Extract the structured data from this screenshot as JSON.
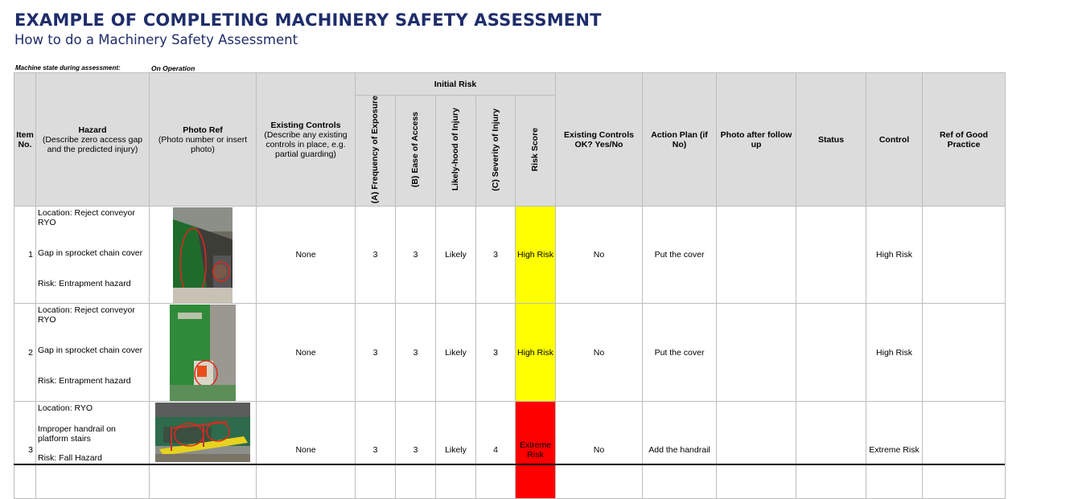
{
  "header": {
    "title": "EXAMPLE OF COMPLETING MACHINERY SAFETY ASSESSMENT",
    "subtitle": "How to do a Machinery Safety Assessment",
    "machine_state_label": "Machine state during assessment:",
    "machine_state_value": "On Operation"
  },
  "columns": {
    "item": "Item No.",
    "hazard_title": "Hazard",
    "hazard_sub": "(Describe zero access gap and the predicted injury)",
    "photo_title": "Photo Ref",
    "photo_sub": "(Photo number or insert photo)",
    "controls_title": "Existing Controls",
    "controls_sub": "(Describe any existing controls in place, e.g. partial guarding)",
    "initial_risk": "Initial Risk",
    "freq": "(A) Frequency of Exposure",
    "ease": "(B) Ease of Access",
    "likely": "Likely-hood of Injury",
    "severity": "(C) Severity of Injury",
    "score": "Risk Score",
    "ok": "Existing Controls OK? Yes/No",
    "action": "Action Plan (if No)",
    "photo_after": "Photo after follow up",
    "status": "Status",
    "control": "Control",
    "ref": "Ref of Good Practice"
  },
  "rows": [
    {
      "item": "1",
      "location": "Location: Reject conveyor RYO",
      "hazard": "Gap in sprocket chain cover",
      "risk": "Risk: Entrapment hazard",
      "photo": "machine-photo-green-guard",
      "controls": "None",
      "freq": "3",
      "ease": "3",
      "likely": "Likely",
      "severity": "3",
      "score": "High Risk",
      "ok": "No",
      "action": "Put the cover",
      "photo_after": "",
      "status": "",
      "control": "High Risk",
      "ref": ""
    },
    {
      "item": "2",
      "location": "Location: Reject conveyor RYO",
      "hazard": "Gap in sprocket chain cover",
      "risk": "Risk: Entrapment hazard",
      "photo": "machine-photo-green-conveyor",
      "controls": "None",
      "freq": "3",
      "ease": "3",
      "likely": "Likely",
      "severity": "3",
      "score": "High Risk",
      "ok": "No",
      "action": "Put the cover",
      "photo_after": "",
      "status": "",
      "control": "High Risk",
      "ref": ""
    },
    {
      "item": "3",
      "location": "Location: RYO",
      "hazard": "Improper handrail on platform stairs",
      "risk": "Risk: Fall Hazard",
      "photo": "platform-stairs-photo",
      "controls": "None",
      "freq": "3",
      "ease": "3",
      "likely": "Likely",
      "severity": "4",
      "score": "Extreme Risk",
      "ok": "No",
      "action": "Add the handrail",
      "photo_after": "",
      "status": "",
      "control": "Extreme Risk",
      "ref": ""
    }
  ],
  "colors": {
    "title": "#1f2d6b",
    "high_risk": "#ffff00",
    "extreme_risk": "#ff0000",
    "header_bg": "#dcdcdc"
  }
}
